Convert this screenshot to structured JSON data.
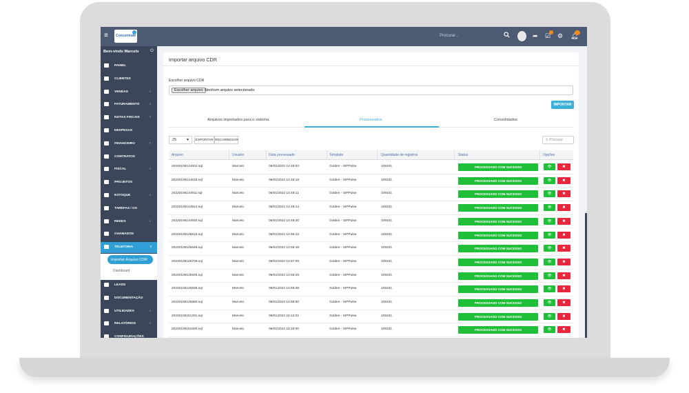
{
  "topbar": {
    "logo_text": "Concentrate",
    "search_placeholder": "Procurar...",
    "search_icon": "search-icon",
    "share_icon": "share-icon",
    "tasks_icon": "checkbox-icon",
    "settings_icon": "gear-icon",
    "bell_icon": "bell-icon",
    "tasks_badge": "2",
    "bell_badge": "19"
  },
  "sidebar": {
    "greeting": "Bem-vindo Marcelo",
    "items": [
      {
        "label": "PAINEL",
        "icon": "dashboard-icon",
        "chevron": false
      },
      {
        "label": "CLIENTES",
        "icon": "user-icon",
        "chevron": false
      },
      {
        "label": "VENDAS",
        "icon": "scale-icon",
        "chevron": true
      },
      {
        "label": "FATURAMENTO",
        "icon": "money-icon",
        "chevron": true
      },
      {
        "label": "NOTAS FISCAIS",
        "icon": "money-icon",
        "chevron": true
      },
      {
        "label": "DESPESAS",
        "icon": "file-icon",
        "chevron": false
      },
      {
        "label": "FINANCEIRO",
        "icon": "money-icon",
        "chevron": true
      },
      {
        "label": "CONTRATOS",
        "icon": "file-icon",
        "chevron": false
      },
      {
        "label": "FISCAL",
        "icon": "scale-icon",
        "chevron": true
      },
      {
        "label": "PROJETOS",
        "icon": "list-icon",
        "chevron": false
      },
      {
        "label": "ESTOQUE",
        "icon": "truck-icon",
        "chevron": true
      },
      {
        "label": "TAREFAS / OS",
        "icon": "tasks-icon",
        "chevron": false
      },
      {
        "label": "REDES",
        "icon": "network-icon",
        "chevron": true
      },
      {
        "label": "CHAMADOS",
        "icon": "ticket-icon",
        "chevron": false
      },
      {
        "label": "TELEFONIA",
        "icon": "phone-icon",
        "chevron": true,
        "active": true
      }
    ],
    "sub_items": [
      "Importar Arquivo CDR",
      "Dashboard"
    ],
    "items_after": [
      {
        "label": "LEADS",
        "icon": "target-icon",
        "chevron": false
      },
      {
        "label": "DOCUMENTAÇÃO",
        "icon": "folder-icon",
        "chevron": false
      },
      {
        "label": "UTILIDADES",
        "icon": "tools-icon",
        "chevron": true
      },
      {
        "label": "RELATÓRIOS",
        "icon": "chart-icon",
        "chevron": true
      },
      {
        "label": "CONFIGURAÇÕES",
        "icon": "gear-icon",
        "chevron": false
      }
    ]
  },
  "main": {
    "title": "Importar arquivo CDR",
    "file_label": "Escolher arquivo CDR",
    "file_button": "Escolher arquivo",
    "file_status": "Nenhum arquivo selecionado",
    "import_button": "IMPORTAR",
    "tabs": [
      "Arquivos importados para o sistema",
      "Processados",
      "Consolidados"
    ],
    "page_length": "25",
    "export_button": "EXPORTAR",
    "reload_button": "RECARREGAR",
    "filter_placeholder": "Procurar",
    "columns": [
      "Arquivo",
      "Usuário",
      "Data processado",
      "Template",
      "Quantidade de registros",
      "Status",
      "Opções"
    ],
    "rows": [
      {
        "file": "20220106144604.sql",
        "user": "Marcelo",
        "date": "06/01/2022 14:48:04",
        "template": "Golden - SIPPulse",
        "count": "109101",
        "status": "PROCESSADO COM SUCESSO"
      },
      {
        "file": "20220106144618.sql",
        "user": "Marcelo",
        "date": "06/01/2022 14:48:18",
        "template": "Golden - SIPPulse",
        "count": "109101",
        "status": "PROCESSADO COM SUCESSO"
      },
      {
        "file": "20220106144911.sql",
        "user": "Marcelo",
        "date": "06/01/2022 14:49:11",
        "template": "Golden - SIPPulse",
        "count": "109101",
        "status": "PROCESSADO COM SUCESSO"
      },
      {
        "file": "20220106144914.sql",
        "user": "Marcelo",
        "date": "06/01/2022 14:49:14",
        "template": "Golden - SIPPulse",
        "count": "109101",
        "status": "PROCESSADO COM SUCESSO"
      },
      {
        "file": "20220106144930.sql",
        "user": "Marcelo",
        "date": "06/01/2022 14:49:30",
        "template": "Golden - SIPPulse",
        "count": "109101",
        "status": "PROCESSADO COM SUCESSO"
      },
      {
        "file": "20220106145615.sql",
        "user": "Marcelo",
        "date": "06/01/2022 14:56:15",
        "template": "Golden - SIPPulse",
        "count": "109101",
        "status": "PROCESSADO COM SUCESSO"
      },
      {
        "file": "20220106145648.sql",
        "user": "Marcelo",
        "date": "06/01/2022 14:56:48",
        "template": "Golden - SIPPulse",
        "count": "109101",
        "status": "PROCESSADO COM SUCESSO"
      },
      {
        "file": "20220106145709.sql",
        "user": "Marcelo",
        "date": "06/01/2022 14:57:09",
        "template": "Golden - SIPPulse",
        "count": "109101",
        "status": "PROCESSADO COM SUCESSO"
      },
      {
        "file": "20220106145925.sql",
        "user": "Marcelo",
        "date": "06/01/2022 14:59:25",
        "template": "Golden - SIPPulse",
        "count": "109101",
        "status": "PROCESSADO COM SUCESSO"
      },
      {
        "file": "20220106145938.sql",
        "user": "Marcelo",
        "date": "06/01/2022 14:59:38",
        "template": "Golden - SIPPulse",
        "count": "109101",
        "status": "PROCESSADO COM SUCESSO"
      },
      {
        "file": "20220106145950.sql",
        "user": "Marcelo",
        "date": "06/01/2022 14:59:50",
        "template": "Golden - SIPPulse",
        "count": "109101",
        "status": "PROCESSADO COM SUCESSO"
      },
      {
        "file": "20220106151201.sql",
        "user": "Marcelo",
        "date": "06/01/2022 15:12:01",
        "template": "Golden - SIPPulse",
        "count": "109101",
        "status": "PROCESSADO COM SUCESSO"
      },
      {
        "file": "20220106161600.sql",
        "user": "Marcelo",
        "date": "06/01/2022 16:16:00",
        "template": "Golden - SIPPulse",
        "count": "109101",
        "status": "PROCESSADO COM SUCESSO"
      }
    ]
  },
  "colors": {
    "topbar": "#4c5b73",
    "sidebar": "#3b465a",
    "accent": "#2f9fd6",
    "success": "#1fbf3a",
    "danger": "#e8273d"
  }
}
